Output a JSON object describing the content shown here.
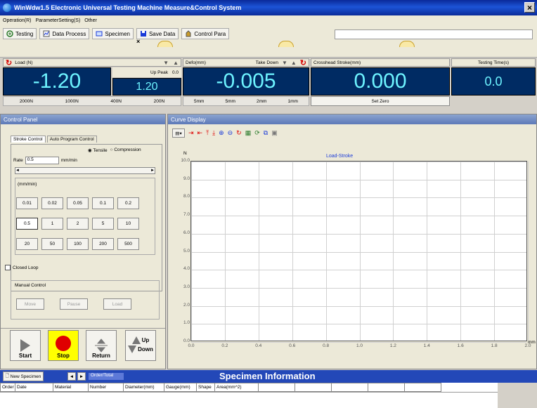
{
  "window": {
    "title": "WinWdw1.5 Electronic Universal Testing Machine Measure&Control System",
    "close": "×"
  },
  "menu": [
    "Operation(R)",
    "ParameterSetting(S)",
    "Other"
  ],
  "toolbar": {
    "items": [
      {
        "label": "Testing",
        "icon": "testing-icon"
      },
      {
        "label": "Data Process",
        "icon": "data-process-icon"
      },
      {
        "label": "Specimen",
        "icon": "specimen-icon"
      },
      {
        "label": "Save Data",
        "icon": "save-icon"
      },
      {
        "label": "Control Para",
        "icon": "control-para-icon"
      }
    ]
  },
  "load": {
    "label": "Load (N)",
    "peak_label": "Up  Peak",
    "peak_small": "0.0",
    "value": "-1.20",
    "peak": "1.20",
    "ranges": [
      "2000N",
      "1000N",
      "400N",
      "200N"
    ]
  },
  "deform": {
    "label": "Defo(mm)",
    "take_down": "Take Down",
    "value": "-0.005",
    "ranges": [
      "5mm",
      "5mm",
      "2mm",
      "1mm"
    ]
  },
  "crosshead": {
    "label": "Crosshead Stroke(mm)",
    "value": "0.000",
    "set_zero": "Set Zero"
  },
  "time": {
    "label": "Testing Time(s)",
    "value": "0.0"
  },
  "control_panel": {
    "title": "Control Panel",
    "tabs": [
      "Stroke Control",
      "Auto Program Control"
    ],
    "tensile": "Tensile",
    "compression": "Compression",
    "rate_label": "Rate",
    "rate_value": "0.5",
    "rate_unit": "mm/min",
    "speed_group": "(mm/min)",
    "speeds": [
      "0.01",
      "0.02",
      "0.05",
      "0.1",
      "0.2",
      "0.5",
      "1",
      "2",
      "5",
      "10",
      "20",
      "50",
      "100",
      "200",
      "500"
    ],
    "closed_loop": "Closed Loop",
    "manual_group": "Manual Control",
    "manual_buttons": [
      "Move",
      "Pause",
      "Load"
    ],
    "big_buttons": {
      "start": "Start",
      "stop": "Stop",
      "return": "Return",
      "up": "Up",
      "down": "Down"
    }
  },
  "curve": {
    "title": "Curve Display",
    "legend": "Load-Stroke",
    "y_unit": "N",
    "x_unit": "mm",
    "colors": {
      "axis": "#555555",
      "grid": "#d0d0d0",
      "legend": "#1a3ad8"
    }
  },
  "chart_data": {
    "type": "line",
    "title": "Load-Stroke",
    "xlabel": "mm",
    "ylabel": "N",
    "xlim": [
      0.0,
      2.0
    ],
    "ylim": [
      0.0,
      10.0
    ],
    "x_ticks": [
      "0.0",
      "0.2",
      "0.4",
      "0.6",
      "0.8",
      "1.0",
      "1.2",
      "1.4",
      "1.6",
      "1.8",
      "2.0"
    ],
    "y_ticks": [
      "0.0",
      "1.0",
      "2.0",
      "3.0",
      "4.0",
      "5.0",
      "6.0",
      "7.0",
      "8.0",
      "9.0",
      "10.0"
    ],
    "series": [],
    "grid": true
  },
  "specimen": {
    "new_label": "New Specimen",
    "order_label": "Order/Total",
    "title": "Specimen Information",
    "columns": [
      "Order",
      "Date",
      "Material",
      "Number",
      "Diameter(mm)",
      "Gauge(mm)",
      "Shape",
      "Area(mm^2)"
    ]
  }
}
